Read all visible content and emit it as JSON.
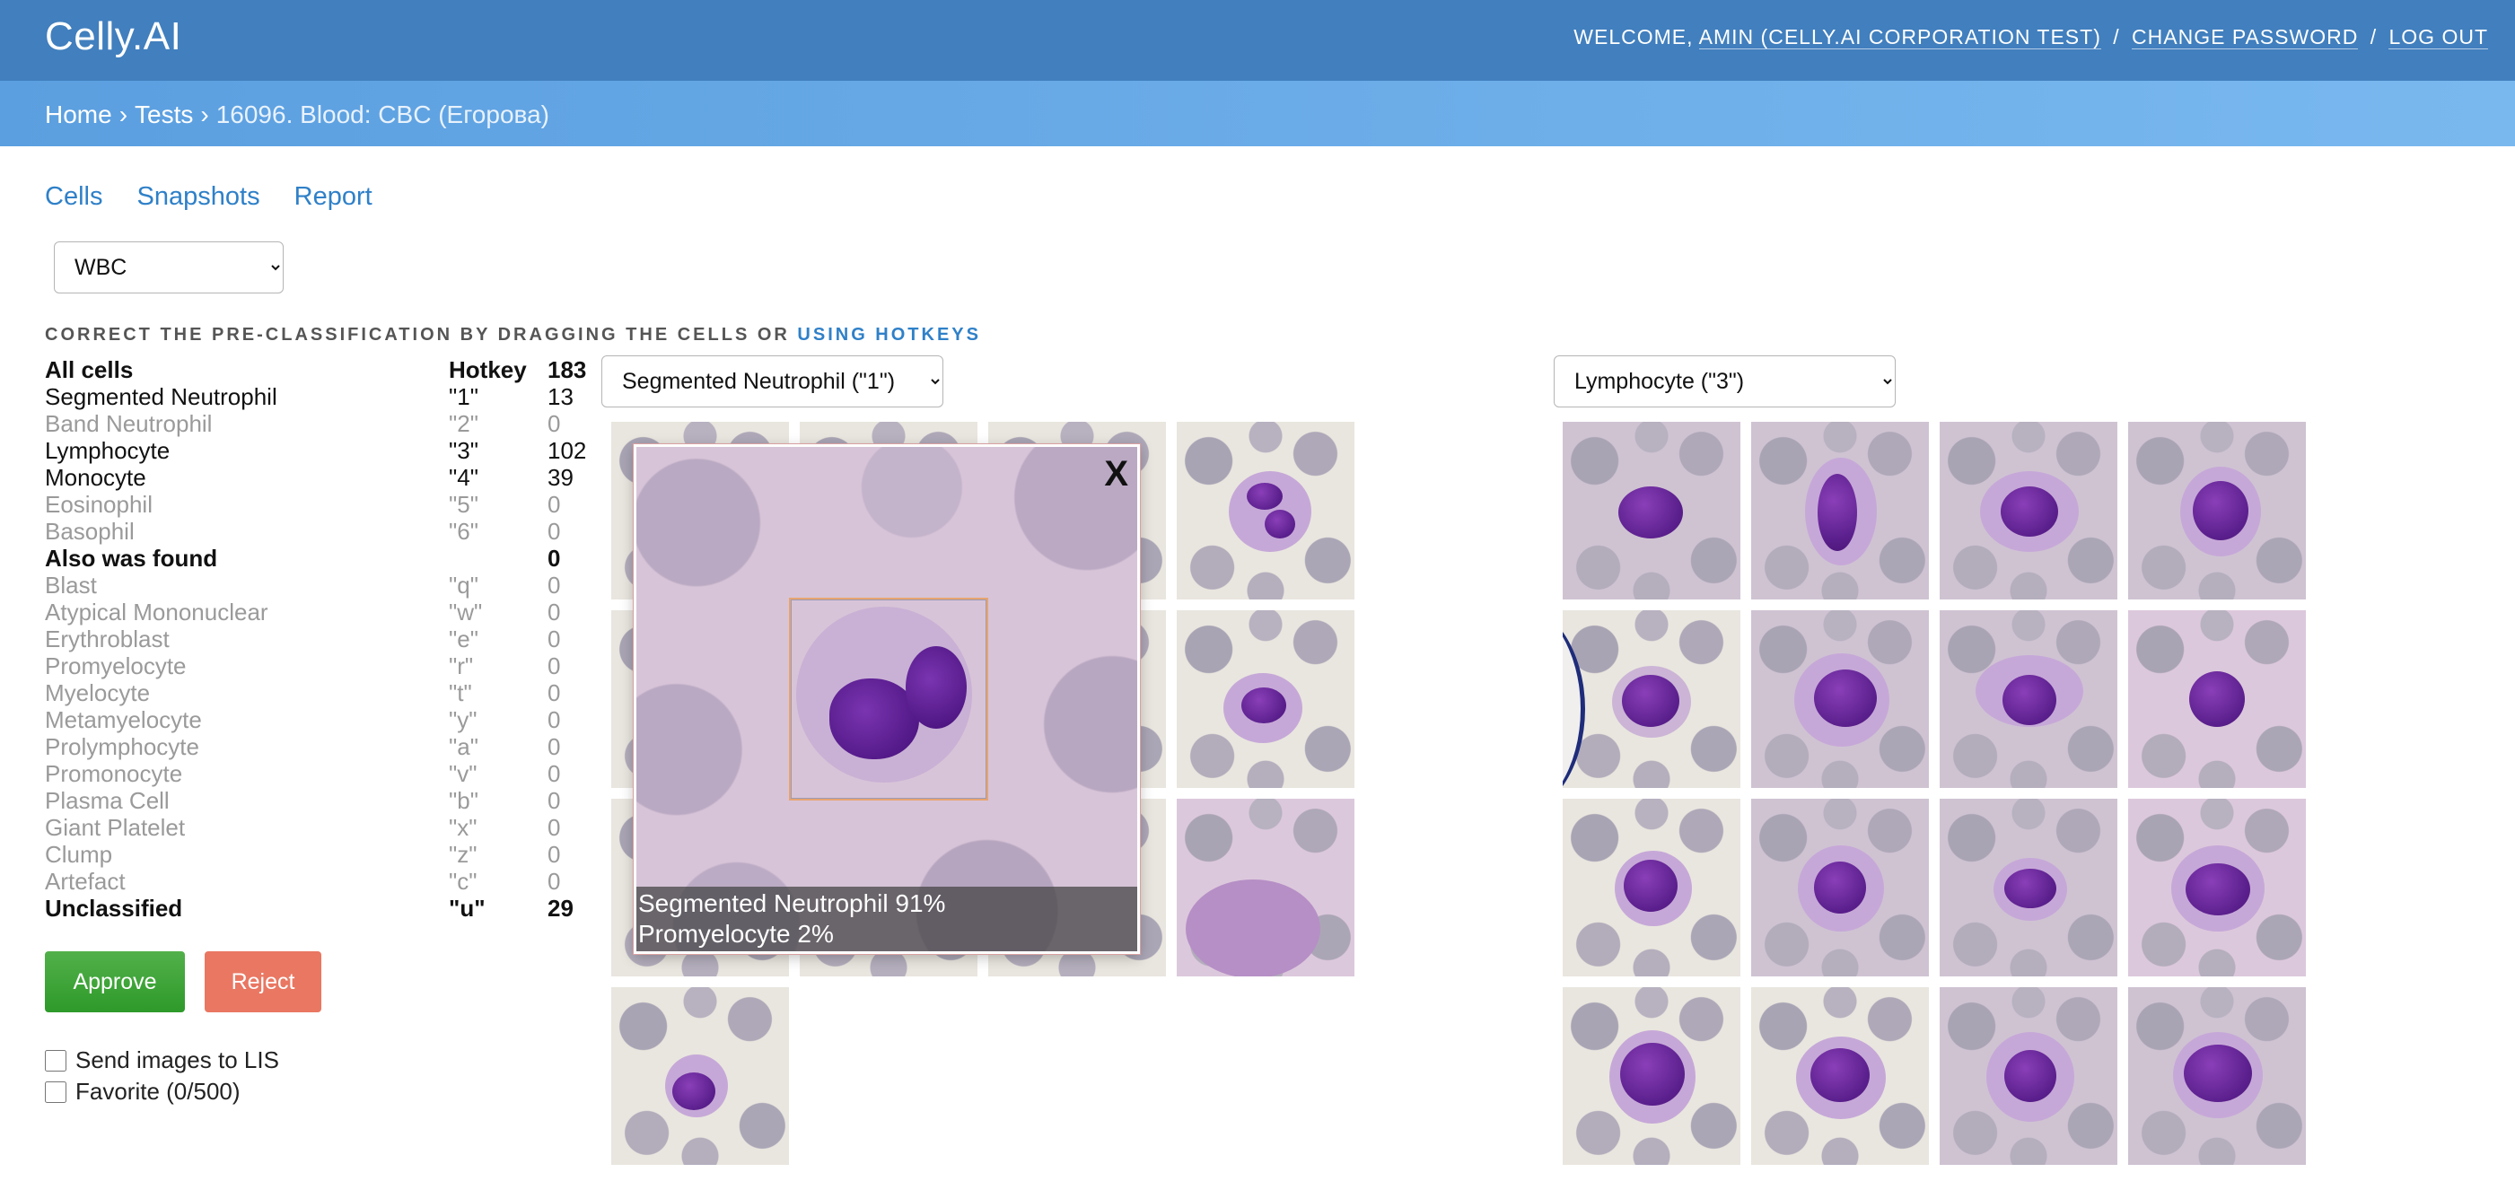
{
  "header": {
    "brand": "Celly.AI",
    "welcome_prefix": "Welcome,",
    "user": "Amin (Celly.AI Corporation Test)",
    "change_password": "Change password",
    "log_out": "Log out",
    "separator": "/"
  },
  "breadcrumbs": {
    "home": "Home",
    "tests": "Tests",
    "current": "16096. Blood: CBC (Егорова)",
    "separator": "›"
  },
  "tabs": [
    "Cells",
    "Snapshots",
    "Report"
  ],
  "type_select": {
    "value": "WBC"
  },
  "instruction": {
    "text": "Correct the pre-classification by dragging the cells or",
    "link": "using hotkeys"
  },
  "class_table": {
    "header": {
      "name": "All cells",
      "hotkey": "Hotkey",
      "count": "183"
    },
    "rows": [
      {
        "name": "Segmented Neutrophil",
        "hotkey": "\"1\"",
        "count": "13"
      },
      {
        "name": "Band Neutrophil",
        "hotkey": "\"2\"",
        "count": "0"
      },
      {
        "name": "Lymphocyte",
        "hotkey": "\"3\"",
        "count": "102"
      },
      {
        "name": "Monocyte",
        "hotkey": "\"4\"",
        "count": "39"
      },
      {
        "name": "Eosinophil",
        "hotkey": "\"5\"",
        "count": "0"
      },
      {
        "name": "Basophil",
        "hotkey": "\"6\"",
        "count": "0"
      },
      {
        "name": "Also was found",
        "hotkey": "",
        "count": "0"
      },
      {
        "name": "Blast",
        "hotkey": "\"q\"",
        "count": "0"
      },
      {
        "name": "Atypical Mononuclear",
        "hotkey": "\"w\"",
        "count": "0"
      },
      {
        "name": "Erythroblast",
        "hotkey": "\"e\"",
        "count": "0"
      },
      {
        "name": "Promyelocyte",
        "hotkey": "\"r\"",
        "count": "0"
      },
      {
        "name": "Myelocyte",
        "hotkey": "\"t\"",
        "count": "0"
      },
      {
        "name": "Metamyelocyte",
        "hotkey": "\"y\"",
        "count": "0"
      },
      {
        "name": "Prolymphocyte",
        "hotkey": "\"a\"",
        "count": "0"
      },
      {
        "name": "Promonocyte",
        "hotkey": "\"v\"",
        "count": "0"
      },
      {
        "name": "Plasma Cell",
        "hotkey": "\"b\"",
        "count": "0"
      },
      {
        "name": "Giant Platelet",
        "hotkey": "\"x\"",
        "count": "0"
      },
      {
        "name": "Clump",
        "hotkey": "\"z\"",
        "count": "0"
      },
      {
        "name": "Artefact",
        "hotkey": "\"c\"",
        "count": "0"
      },
      {
        "name": "Unclassified",
        "hotkey": "\"u\"",
        "count": "29"
      }
    ]
  },
  "buttons": {
    "approve": "Approve",
    "reject": "Reject"
  },
  "checkboxes": {
    "send_lis": "Send images to LIS",
    "favorite": "Favorite (0/500)"
  },
  "left_panel": {
    "selected": "Segmented Neutrophil (\"1\")"
  },
  "right_panel": {
    "selected": "Lymphocyte (\"3\")"
  },
  "zoom": {
    "close": "X",
    "predictions": [
      "Segmented Neutrophil 91%",
      "Promyelocyte 2%"
    ]
  }
}
